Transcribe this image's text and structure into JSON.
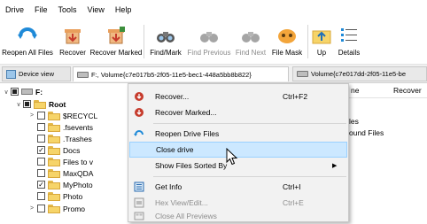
{
  "menubar": [
    "Drive",
    "File",
    "Tools",
    "View",
    "Help"
  ],
  "toolbar": [
    {
      "label": "Reopen All Files",
      "icon": "refresh-icon",
      "enabled": true
    },
    {
      "label": "Recover",
      "icon": "recover-icon",
      "enabled": true
    },
    {
      "label": "Recover Marked",
      "icon": "recover-marked-icon",
      "enabled": true
    },
    {
      "label": "Find/Mark",
      "icon": "binoculars-icon",
      "enabled": true
    },
    {
      "label": "Find Previous",
      "icon": "binoculars-prev-icon",
      "enabled": false
    },
    {
      "label": "Find Next",
      "icon": "binoculars-next-icon",
      "enabled": false
    },
    {
      "label": "File Mask",
      "icon": "file-mask-icon",
      "enabled": true
    },
    {
      "label": "Up",
      "icon": "folder-up-icon",
      "enabled": true
    },
    {
      "label": "Details",
      "icon": "details-icon",
      "enabled": true
    }
  ],
  "tabs": {
    "device": "Device view",
    "vol1": "F:, Volume{c7e017b5-2f05-11e5-bec1-448a5bb8b822}",
    "vol2": "Volume{c7e017dd-2f05-11e5-be"
  },
  "tree": {
    "drive": "F:",
    "root": "Root",
    "items": [
      {
        "label": "$RECYCL",
        "checked": false,
        "expander": ">"
      },
      {
        "label": ".fsevents",
        "checked": false,
        "expander": ""
      },
      {
        "label": ".Trashes",
        "checked": false,
        "expander": ""
      },
      {
        "label": "Docs",
        "checked": true,
        "expander": ""
      },
      {
        "label": "Files to v",
        "checked": false,
        "expander": ""
      },
      {
        "label": "MaxQDA",
        "checked": false,
        "expander": ""
      },
      {
        "label": "MyPhoto",
        "checked": true,
        "expander": ""
      },
      {
        "label": "Photo",
        "checked": false,
        "expander": ""
      },
      {
        "label": "Promo",
        "checked": false,
        "expander": ">"
      }
    ]
  },
  "rightpane": {
    "col_name": "ne",
    "col_recover": "Recover",
    "items": [
      "les",
      "ound Files"
    ]
  },
  "context_menu": [
    {
      "label": "Recover...",
      "shortcut": "Ctrl+F2",
      "icon": "recover-icon",
      "enabled": true,
      "highlight": false
    },
    {
      "label": "Recover Marked...",
      "shortcut": "",
      "icon": "recover-marked-icon",
      "enabled": true,
      "highlight": false
    },
    {
      "sep": true
    },
    {
      "label": "Reopen Drive Files",
      "shortcut": "",
      "icon": "refresh-icon",
      "enabled": true,
      "highlight": false
    },
    {
      "label": "Close drive",
      "shortcut": "",
      "icon": "",
      "enabled": true,
      "highlight": true
    },
    {
      "label": "Show Files Sorted By",
      "shortcut": "",
      "icon": "",
      "enabled": true,
      "highlight": false,
      "submenu": "▶"
    },
    {
      "sep": true
    },
    {
      "label": "Get Info",
      "shortcut": "Ctrl+I",
      "icon": "info-icon",
      "enabled": true,
      "highlight": false
    },
    {
      "label": "Hex View/Edit...",
      "shortcut": "Ctrl+E",
      "icon": "hex-icon",
      "enabled": false,
      "highlight": false
    },
    {
      "label": "Close All Previews",
      "shortcut": "",
      "icon": "previews-icon",
      "enabled": false,
      "highlight": false
    }
  ]
}
